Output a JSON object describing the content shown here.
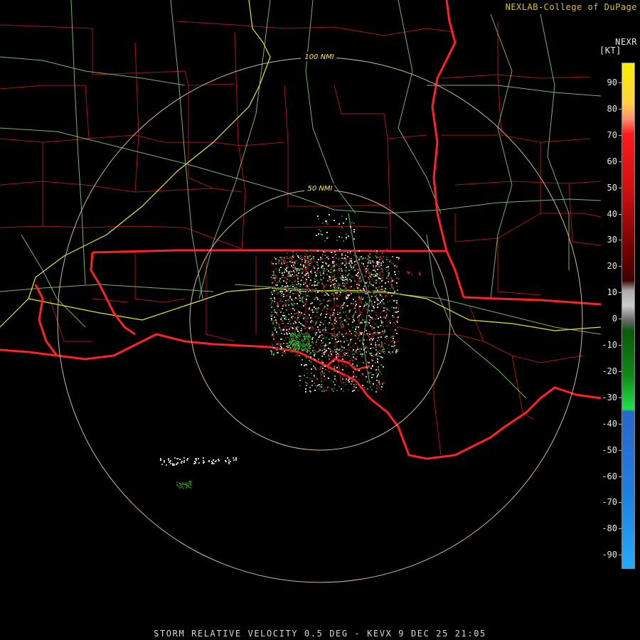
{
  "header": {
    "attribution": "NEXLAB-College of DuPage",
    "product_code": "NEXR",
    "units": "[KT]"
  },
  "range_rings": [
    {
      "label": "100 NMI"
    },
    {
      "label": "50 NMI"
    }
  ],
  "colorbar": {
    "labels": [
      "90",
      "80",
      "70",
      "60",
      "50",
      "40",
      "30",
      "20",
      "10",
      "0",
      "-10",
      "-20",
      "-30",
      "-40",
      "-50",
      "-60",
      "-70",
      "-80",
      "-90"
    ],
    "colors": {
      "positive_high": "#ffee00",
      "positive_mid": "#ff1a1a",
      "positive_low": "#6b0000",
      "near_zero": "#cccccc",
      "negative_low": "#0a5a0a",
      "negative_mid": "#19e043",
      "negative_high": "#2a66cc"
    }
  },
  "map_colors": {
    "state_border": "#ff2a2a",
    "county_lines": "#b01818",
    "highways": "#8fd47a",
    "interstates": "#e6e61e",
    "range_rings": "#d8b89a"
  },
  "footer": {
    "title": "STORM RELATIVE VELOCITY 0.5 DEG - KEVX 9 DEC 25 21:05"
  }
}
